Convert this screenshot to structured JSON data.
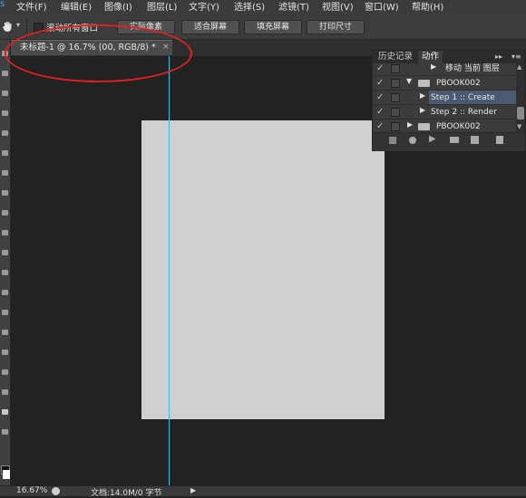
{
  "menu": {
    "ps_logo": "s",
    "items": [
      "文件(F)",
      "编辑(E)",
      "图像(I)",
      "图层(L)",
      "文字(Y)",
      "选择(S)",
      "滤镜(T)",
      "视图(V)",
      "窗口(W)",
      "帮助(H)"
    ]
  },
  "options": {
    "scroll_all": "滚动所有窗口",
    "actual_pixels": "实际像素",
    "fit_screen": "适合屏幕",
    "fill_screen": "填充屏幕",
    "print_size": "打印尺寸"
  },
  "document": {
    "tab_title": "未标题-1 @ 16.7% (00, RGB/8) *",
    "close": "×",
    "canvas_color": "#d0d0d0",
    "guide_color": "#3fc0e8"
  },
  "actions_panel": {
    "tabs": [
      "历史记录",
      "动作"
    ],
    "collapse": "▸▸",
    "menu": "▾≡",
    "rows": [
      {
        "check": "✓",
        "label": "移动 当前 图层",
        "type": "step"
      },
      {
        "check": "✓",
        "label": "PBOOK002",
        "type": "set-open"
      },
      {
        "check": "✓",
        "label": "Step 1 :: Create",
        "type": "action-selected"
      },
      {
        "check": "✓",
        "label": "Step 2 :: Render",
        "type": "action"
      },
      {
        "check": "✓",
        "label": "PBOOK002",
        "type": "set-closed"
      }
    ]
  },
  "status": {
    "zoom": "16.67%",
    "doc_info": "文档:14.0M/0 字节",
    "arrow": "▶"
  },
  "annotation": {
    "color": "#e02020"
  }
}
